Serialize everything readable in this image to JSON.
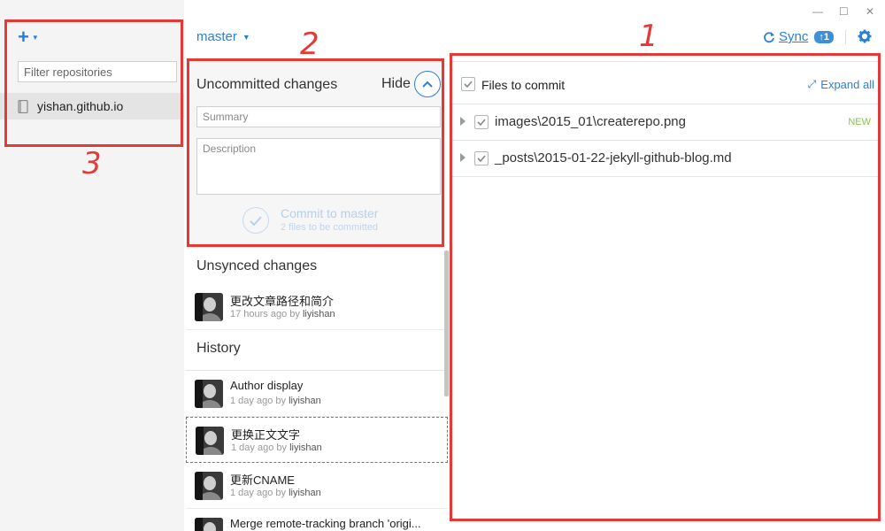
{
  "sidebar": {
    "add_icon": "plus-icon",
    "filter_placeholder": "Filter repositories",
    "repos": [
      {
        "name": "yishan.github.io",
        "icon": "book-icon"
      }
    ]
  },
  "branch": {
    "name": "master"
  },
  "uncommitted": {
    "title": "Uncommitted changes",
    "hide_label": "Hide",
    "summary_placeholder": "Summary",
    "description_placeholder": "Description",
    "commit_label": "Commit to master",
    "commit_sub": "2 files to be committed"
  },
  "unsynced": {
    "title": "Unsynced changes",
    "commits": [
      {
        "message": "更改文章路径和简介",
        "time": "17 hours ago by ",
        "author": "liyishan"
      }
    ]
  },
  "history": {
    "title": "History",
    "commits": [
      {
        "message": "Author display",
        "time": "1 day ago by ",
        "author": "liyishan"
      },
      {
        "message": "更换正文文字",
        "time": "1 day ago by ",
        "author": "liyishan"
      },
      {
        "message": "更新CNAME",
        "time": "1 day ago by ",
        "author": "liyishan"
      },
      {
        "message": "Merge remote-tracking branch 'origi...",
        "time": "",
        "author": ""
      }
    ]
  },
  "toolbar": {
    "sync_label": "Sync",
    "sync_badge": "↑1",
    "settings_icon": "gear-icon"
  },
  "window": {
    "minimize": "—",
    "maximize": "☐",
    "close": "✕"
  },
  "files": {
    "header": "Files to commit",
    "expand_all": "Expand all",
    "items": [
      {
        "path": "images\\2015_01\\createrepo.png",
        "badge": "NEW"
      },
      {
        "path": "_posts\\2015-01-22-jekyll-github-blog.md",
        "badge": ""
      }
    ]
  },
  "annotations": {
    "one": "1",
    "two": "2",
    "three": "3"
  },
  "colors": {
    "accent": "#2d7fd3",
    "annotation": "#e53935",
    "new_badge": "#8bc34a"
  }
}
